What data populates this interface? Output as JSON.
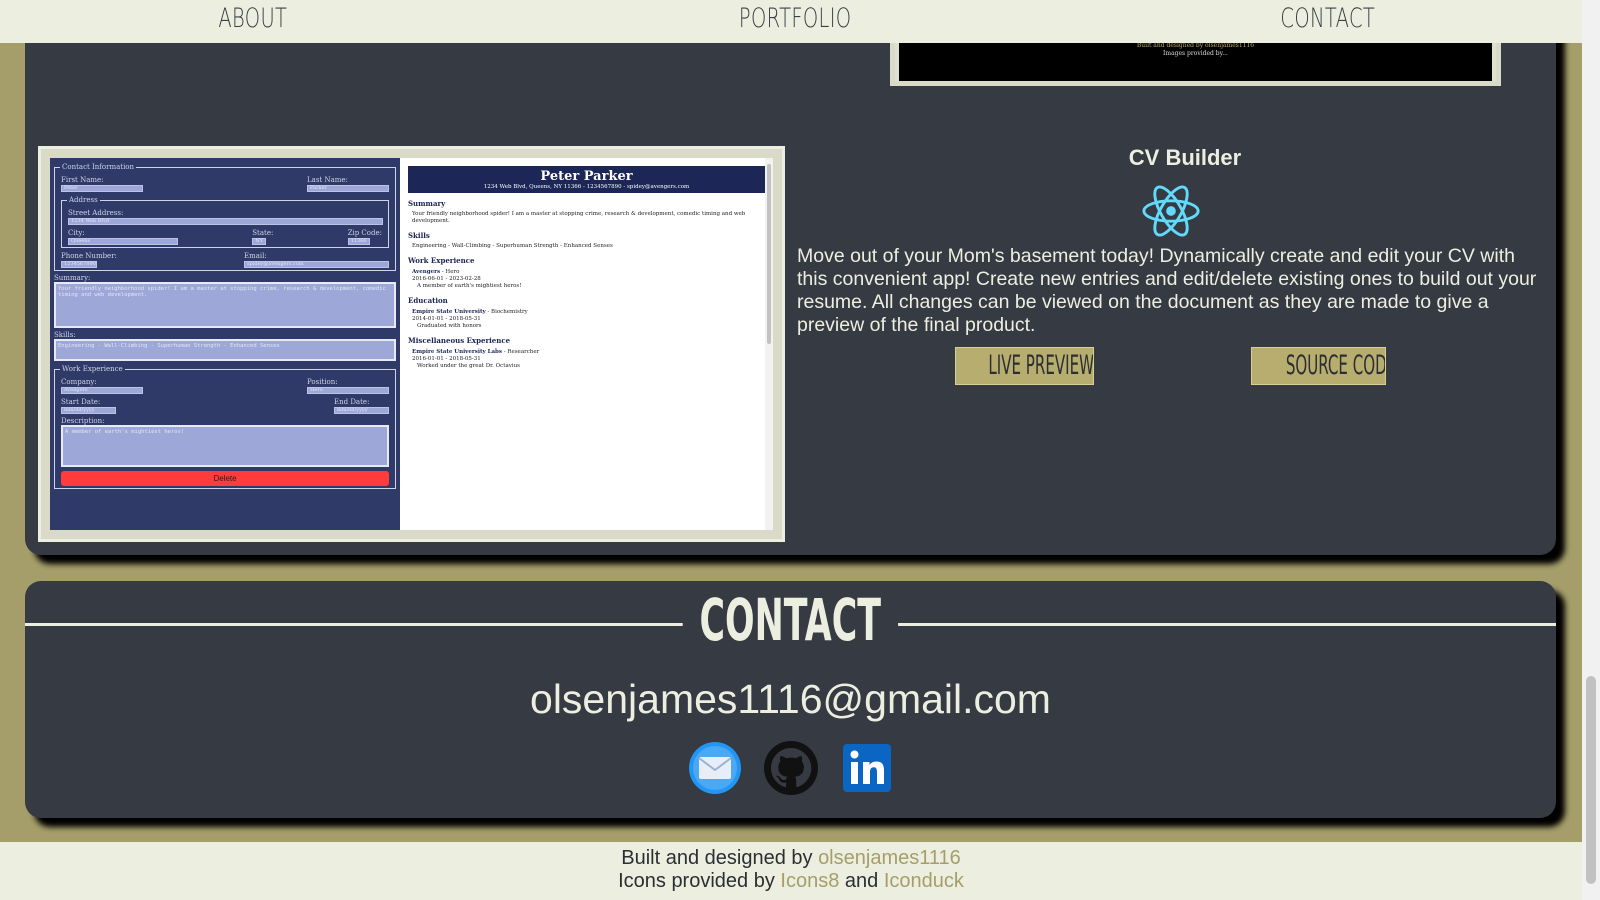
{
  "nav": {
    "items": [
      "About",
      "Portfolio",
      "Contact"
    ]
  },
  "prev_project": {
    "credit_line1": "Built and designed by",
    "credit_name": "olsenjames1116",
    "credit_line2": "Images provided by..."
  },
  "project": {
    "title": "CV Builder",
    "icon": "react-icon",
    "description": "Move out of your Mom's basement today! Dynamically create and edit your CV with this convenient app! Create new entries and edit/delete existing ones to build out your resume. All changes can be viewed on the document as they are made to give a preview of the final product.",
    "live_preview_label": "Live Preview",
    "source_code_label": "Source Code",
    "screenshot": {
      "contact_legend": "Contact Information",
      "first_name_label": "First Name:",
      "first_name_val": "Peter",
      "last_name_label": "Last Name:",
      "last_name_val": "Parker",
      "address_legend": "Address",
      "street_label": "Street Address:",
      "street_val": "1234 Web Blvd",
      "city_label": "City:",
      "city_val": "Queens",
      "state_label": "State:",
      "state_val": "NY",
      "zip_label": "Zip Code:",
      "zip_val": "11366",
      "phone_label": "Phone Number:",
      "phone_val": "1234567890",
      "email_label": "Email:",
      "email_val": "spidey@avengers.com",
      "summary_label": "Summary:",
      "summary_val": "Your friendly neighborhood spider! I am a master at stopping crime, research & development, comedic timing and web development.",
      "skills_label": "Skills:",
      "skills_val": "Engineering - Wall-Climbing - Superhuman Strength - Enhanced Senses",
      "work_legend": "Work Experience",
      "company_label": "Company:",
      "company_val": "Avengers",
      "position_label": "Position:",
      "position_val": "Hero",
      "start_label": "Start Date:",
      "start_val": "mm/dd/yyyy",
      "end_label": "End Date:",
      "end_val": "mm/dd/yyyy",
      "desc_label": "Description:",
      "desc_val": "A member of earth's mightiest heros!",
      "delete_label": "Delete",
      "doc_name": "Peter Parker",
      "doc_contact": "1234 Web Blvd, Queens, NY 11366 - 1234567890 - spidey@avengers.com",
      "doc_summary_h": "Summary",
      "doc_summary": "Your friendly neighborhood spider! I am a master at stopping crime, research & development, comedic timing and web development.",
      "doc_skills_h": "Skills",
      "doc_skills": "Engineering - Wall-Climbing - Superhuman Strength - Enhanced Senses",
      "doc_work_h": "Work Experience",
      "doc_work_title": "Avengers",
      "doc_work_role": " - Hero",
      "doc_work_dates": "2016-06-01 - 2023-02-28",
      "doc_work_desc": "A member of earth's mightiest heros!",
      "doc_edu_h": "Education",
      "doc_edu_title": "Empire State University",
      "doc_edu_role": " - Biochemistry",
      "doc_edu_dates": "2014-01-01 - 2018-05-31",
      "doc_edu_desc": "Graduated with honors",
      "doc_misc_h": "Miscellaneous Experience",
      "doc_misc_title": "Empire State University Labs",
      "doc_misc_role": " - Researcher",
      "doc_misc_dates": "2016-01-01 - 2018-05-31",
      "doc_misc_desc": "Worked under the great Dr. Octavius"
    }
  },
  "contact": {
    "title": "Contact",
    "email": "olsenjames1116@gmail.com",
    "icons": [
      "mail-icon",
      "github-icon",
      "linkedin-icon"
    ]
  },
  "footer": {
    "built_by": "Built and designed by",
    "author": "olsenjames1116",
    "icons_by": "Icons provided by",
    "source1": "Icons8",
    "and": "and",
    "source2": "Iconduck"
  },
  "colors": {
    "background": "#a59e6a",
    "panel": "#363a42",
    "cream": "#ecefe0",
    "button": "#b7ad6e"
  }
}
